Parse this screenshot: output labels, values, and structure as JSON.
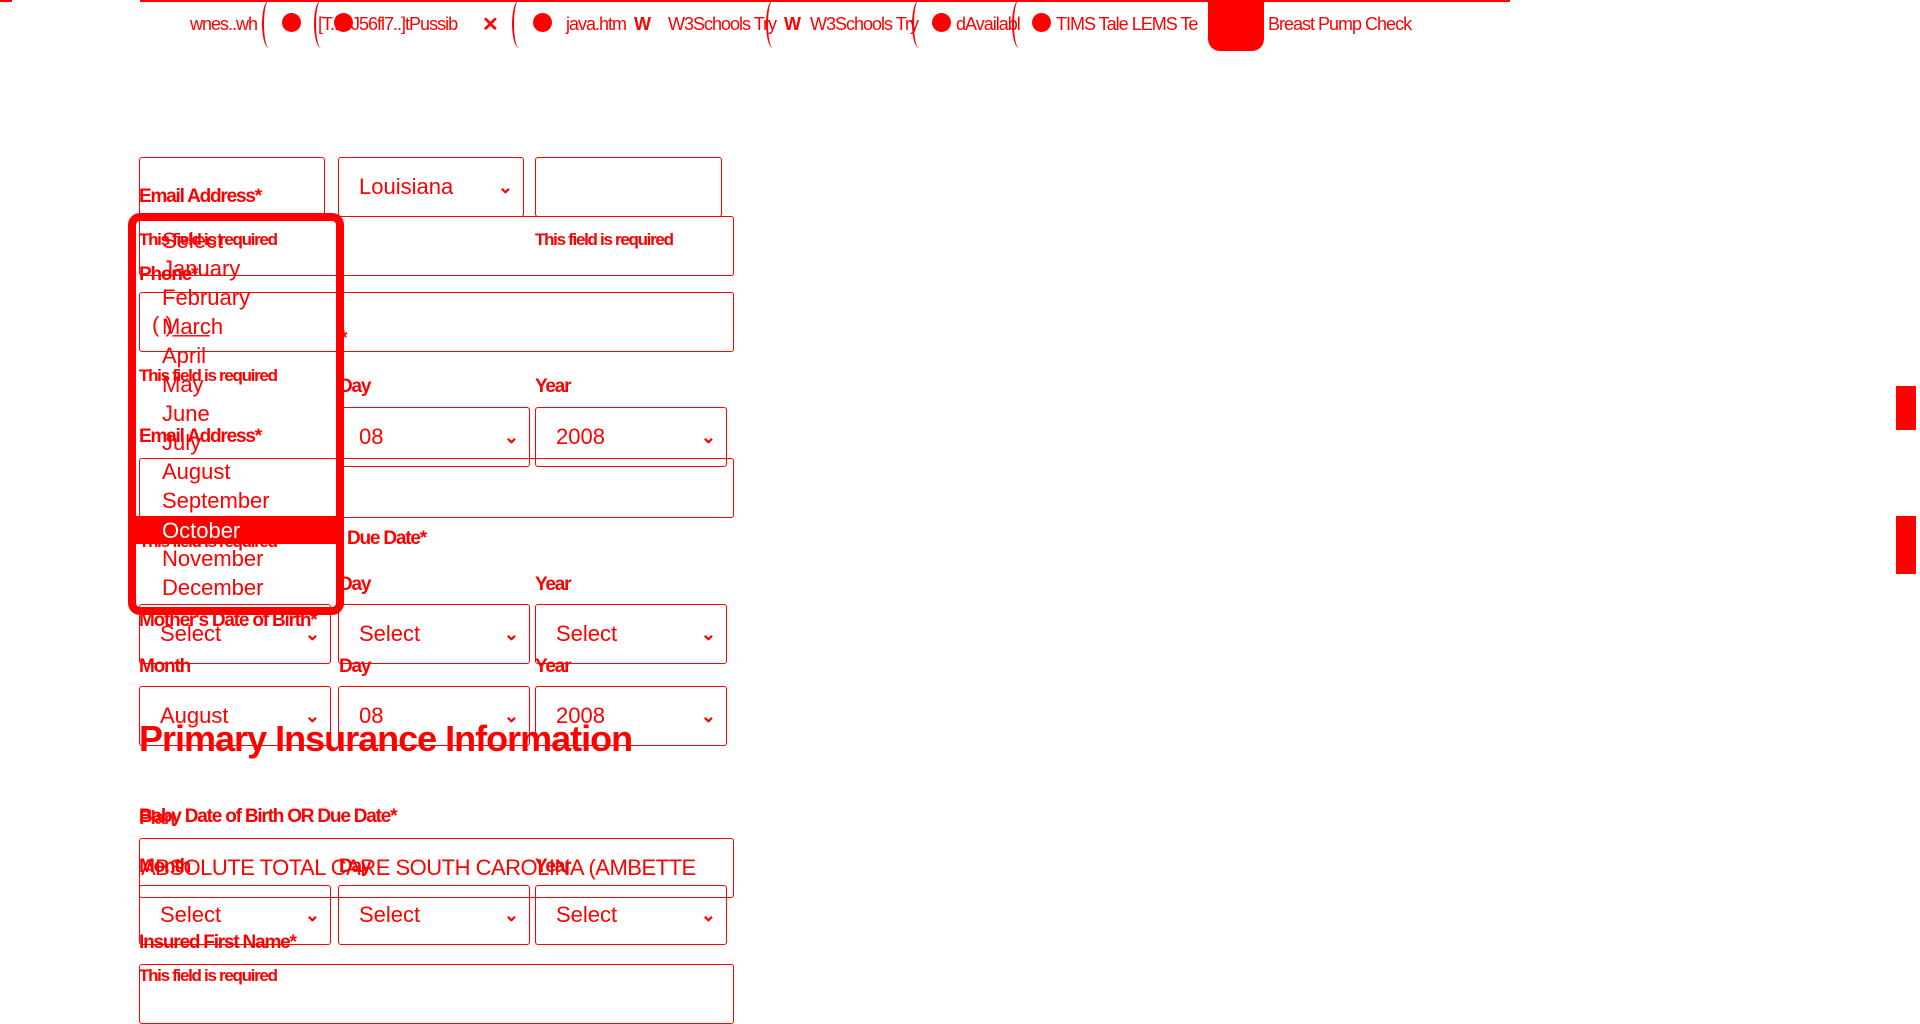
{
  "tabs": [
    {
      "label": "wnes..wh"
    },
    {
      "label": "[T...0J56fl7..]tPussib"
    },
    {
      "label": "java.htm"
    },
    {
      "label": "W3Schools Try"
    },
    {
      "label": "W3Schools Try"
    },
    {
      "label": "dAvailabl"
    },
    {
      "label": "TIMS Tale LEMS Te"
    },
    {
      "label": "Breast Pump Check"
    }
  ],
  "form": {
    "labels": {
      "email_1": "Email Address*",
      "phone": "Phone*",
      "email_2": "Email Address*",
      "baby_dob_due": "Baby Date of Birth OR Due Date*",
      "due_date_short": "Due Date*",
      "mothers_dob": "Mother's Date of Birth*",
      "month": "Month",
      "day": "Day",
      "year": "Year",
      "day_2": "Day",
      "year_2": "Year",
      "day_3": "Day",
      "year_3": "Year",
      "baby_dob_due_2": "Baby Date of Birth OR Due Date*",
      "plan": "Plan",
      "month_2": "Month",
      "day_4": "Day",
      "year_4": "Year",
      "insured_first_name": "Insured First Name*",
      "asterisk": "*"
    },
    "errors": {
      "required": "This field is required"
    },
    "state_select": "Louisiana",
    "phone_value": "(   )___",
    "dob": {
      "day": "08",
      "year": "2008"
    },
    "due": {
      "month": "Select",
      "day": "Select",
      "year": "Select"
    },
    "mothers": {
      "month": "August",
      "day": "08",
      "year": "2008"
    },
    "insurance_heading": "Primary Insurance Information",
    "insurance_plan": "ABSOLUTE TOTAL CARE SOUTH CAROLINA (AMBETTE",
    "baby2": {
      "month": "Select",
      "day": "Select",
      "year": "Select"
    }
  },
  "month_dropdown": {
    "options": [
      "January",
      "February",
      "March",
      "April",
      "May",
      "June",
      "July",
      "August",
      "September",
      "October",
      "November",
      "December"
    ],
    "selected": "October",
    "header": "Select"
  },
  "colors": {
    "primary": "#ff0000",
    "background": "#ffffff"
  }
}
